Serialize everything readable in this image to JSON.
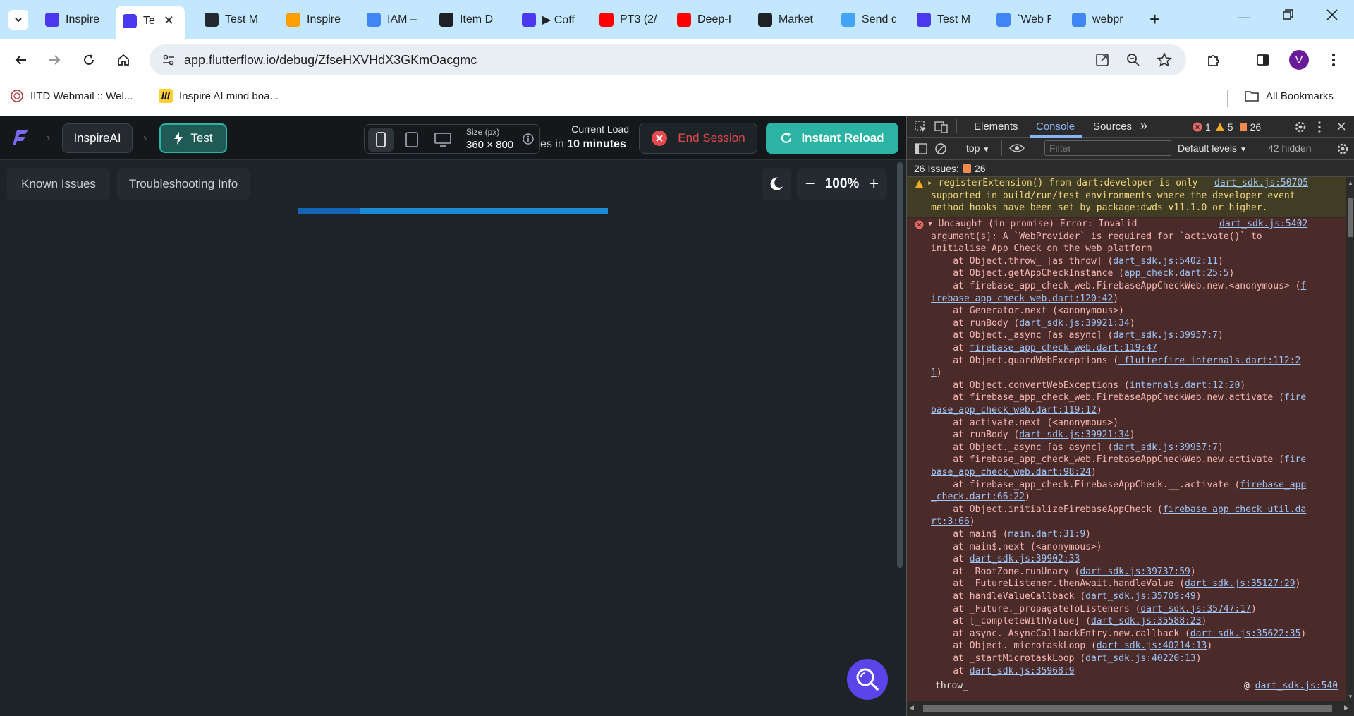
{
  "browser": {
    "tabs": [
      {
        "label": "Inspire",
        "icon": "flutterflow-icon",
        "color": "#4b39ef"
      },
      {
        "label": "Te",
        "icon": "flutterflow-icon",
        "color": "#4b39ef",
        "active": true
      },
      {
        "label": "Test M",
        "icon": "github-icon",
        "color": "#24292f"
      },
      {
        "label": "Inspire",
        "icon": "firebase-icon",
        "color": "#ffa000"
      },
      {
        "label": "IAM – ",
        "icon": "shield-icon",
        "color": "#4285f4"
      },
      {
        "label": "Item D",
        "icon": "app-icon",
        "color": "#202124"
      },
      {
        "label": "▶ Coff",
        "icon": "flutterflow-icon",
        "color": "#4b39ef"
      },
      {
        "label": "PT3 (2/",
        "icon": "youtube-icon",
        "color": "#ff0000"
      },
      {
        "label": "Deep-I",
        "icon": "youtube-icon",
        "color": "#ff0000"
      },
      {
        "label": "Market",
        "icon": "app-icon",
        "color": "#202124"
      },
      {
        "label": "Send d",
        "icon": "flutter-icon",
        "color": "#42a5f5"
      },
      {
        "label": "Test M",
        "icon": "flutterflow-icon",
        "color": "#4b39ef"
      },
      {
        "label": "`Web F",
        "icon": "google-icon",
        "color": "#4285f4"
      },
      {
        "label": "webpr",
        "icon": "google-icon",
        "color": "#4285f4"
      }
    ],
    "url": "app.flutterflow.io/debug/ZfseHXVHdX3GKmOacgmc",
    "profile_initial": "V",
    "bookmarks": [
      {
        "label": "IITD Webmail :: Wel..."
      },
      {
        "label": "Inspire AI mind boa..."
      }
    ],
    "all_bookmarks": "All Bookmarks"
  },
  "flutterflow": {
    "project": "InspireAI",
    "mode": "Test",
    "size_label": "Size (px)",
    "size_value": "360 × 800",
    "load_label": "Current Load",
    "load_prefix": "es in ",
    "load_value": "10 minutes",
    "end_session": "End Session",
    "instant_reload": "Instant Reload",
    "known_issues": "Known Issues",
    "troubleshooting": "Troubleshooting Info",
    "zoom": "100%",
    "progress_fraction": 0.2
  },
  "devtools": {
    "tabs": [
      "Elements",
      "Console",
      "Sources"
    ],
    "active_tab": "Console",
    "error_count": "1",
    "warning_count": "5",
    "issue_count": "26",
    "context": "top",
    "filter_placeholder": "Filter",
    "levels": "Default levels",
    "hidden": "42 hidden",
    "issues_label": "26 Issues:",
    "issues_badge": "26",
    "warning_lines": [
      "registerExtension() from dart:developer is only ",
      "supported in build/run/test environments where the developer event",
      "method hooks have been set by package:dwds v11.1.0 or higher."
    ],
    "warning_link": "dart_sdk.js:50705",
    "error_head": "Uncaught (in promise) Error: Invalid",
    "error_head_link": "dart_sdk.js:5402",
    "error_lines": [
      "argument(s): A `WebProvider` is required for `activate()` to",
      "initialise App Check on the web platform"
    ],
    "stack": [
      {
        "text": "    at Object.throw_ [as throw] (",
        "link": "dart_sdk.js:5402:11",
        "tail": ")"
      },
      {
        "text": "    at Object.getAppCheckInstance (",
        "link": "app_check.dart:25:5",
        "tail": ")"
      },
      {
        "text": "    at firebase_app_check_web.FirebaseAppCheckWeb.new.<anonymous> (",
        "link": "f",
        "tail": ""
      },
      {
        "text": "",
        "link": "irebase_app_check_web.dart:120:42",
        "tail": ")"
      },
      {
        "text": "    at Generator.next (<anonymous>)",
        "link": "",
        "tail": ""
      },
      {
        "text": "    at runBody (",
        "link": "dart_sdk.js:39921:34",
        "tail": ")"
      },
      {
        "text": "    at Object._async [as async] (",
        "link": "dart_sdk.js:39957:7",
        "tail": ")"
      },
      {
        "text": "    at ",
        "link": "firebase_app_check_web.dart:119:47",
        "tail": ""
      },
      {
        "text": "    at Object.guardWebExceptions (",
        "link": "_flutterfire_internals.dart:112:2",
        "tail": ""
      },
      {
        "text": "",
        "link": "1",
        "tail": ")"
      },
      {
        "text": "    at Object.convertWebExceptions (",
        "link": "internals.dart:12:20",
        "tail": ")"
      },
      {
        "text": "    at firebase_app_check_web.FirebaseAppCheckWeb.new.activate (",
        "link": "fire",
        "tail": ""
      },
      {
        "text": "",
        "link": "base_app_check_web.dart:119:12",
        "tail": ")"
      },
      {
        "text": "    at activate.next (<anonymous>)",
        "link": "",
        "tail": ""
      },
      {
        "text": "    at runBody (",
        "link": "dart_sdk.js:39921:34",
        "tail": ")"
      },
      {
        "text": "    at Object._async [as async] (",
        "link": "dart_sdk.js:39957:7",
        "tail": ")"
      },
      {
        "text": "    at firebase_app_check_web.FirebaseAppCheckWeb.new.activate (",
        "link": "fire",
        "tail": ""
      },
      {
        "text": "",
        "link": "base_app_check_web.dart:98:24",
        "tail": ")"
      },
      {
        "text": "    at firebase_app_check.FirebaseAppCheck.__.activate (",
        "link": "firebase_app",
        "tail": ""
      },
      {
        "text": "",
        "link": "_check.dart:66:22",
        "tail": ")"
      },
      {
        "text": "    at Object.initializeFirebaseAppCheck (",
        "link": "firebase_app_check_util.da",
        "tail": ""
      },
      {
        "text": "",
        "link": "rt:3:66",
        "tail": ")"
      },
      {
        "text": "    at main$ (",
        "link": "main.dart:31:9",
        "tail": ")"
      },
      {
        "text": "    at main$.next (<anonymous>)",
        "link": "",
        "tail": ""
      },
      {
        "text": "    at ",
        "link": "dart_sdk.js:39902:33",
        "tail": ""
      },
      {
        "text": "    at _RootZone.runUnary (",
        "link": "dart_sdk.js:39737:59",
        "tail": ")"
      },
      {
        "text": "    at _FutureListener.thenAwait.handleValue (",
        "link": "dart_sdk.js:35127:29",
        "tail": ")"
      },
      {
        "text": "    at handleValueCallback (",
        "link": "dart_sdk.js:35709:49",
        "tail": ")"
      },
      {
        "text": "    at _Future._propagateToListeners (",
        "link": "dart_sdk.js:35747:17",
        "tail": ")"
      },
      {
        "text": "    at [_completeWithValue] (",
        "link": "dart_sdk.js:35588:23",
        "tail": ")"
      },
      {
        "text": "    at async._AsyncCallbackEntry.new.callback (",
        "link": "dart_sdk.js:35622:35",
        "tail": ")"
      },
      {
        "text": "    at Object._microtaskLoop (",
        "link": "dart_sdk.js:40214:13",
        "tail": ")"
      },
      {
        "text": "    at _startMicrotaskLoop (",
        "link": "dart_sdk.js:40220:13",
        "tail": ")"
      },
      {
        "text": "    at ",
        "link": "dart_sdk.js:35968:9",
        "tail": ""
      }
    ],
    "throw_label": "throw_",
    "throw_link": "dart_sdk.js:540"
  },
  "colors": {
    "ff_teal": "#2bb3a3",
    "ff_red": "#e5484d",
    "progress": "#1b8ad8"
  }
}
